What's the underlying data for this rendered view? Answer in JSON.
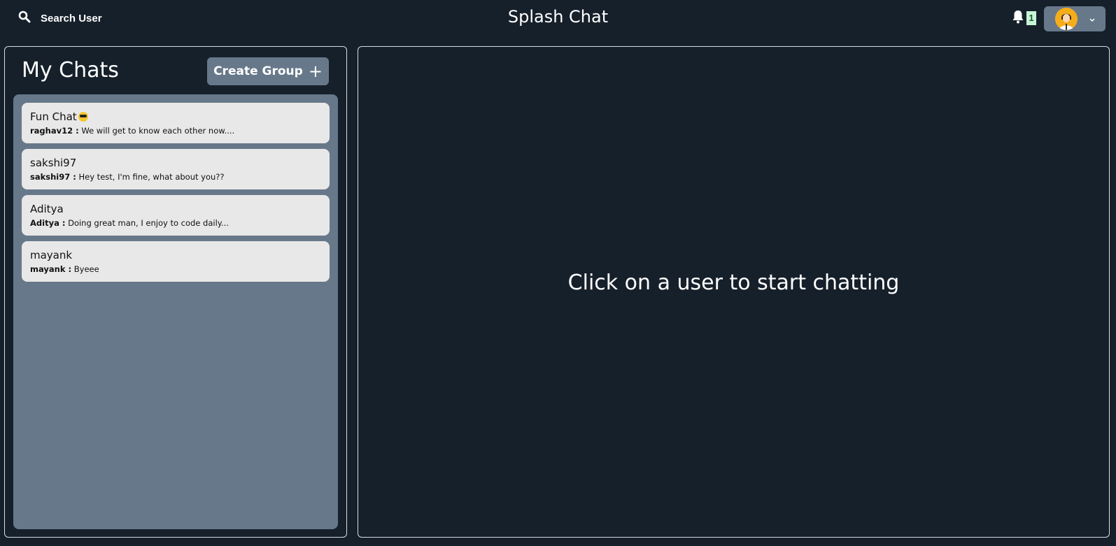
{
  "header": {
    "search_label": "Search User",
    "app_title": "Splash Chat",
    "notification_count": "1"
  },
  "sidebar": {
    "title": "My Chats",
    "create_group_label": "Create Group",
    "chats": [
      {
        "name": "Fun Chat",
        "sender": "raghav12 :",
        "message": "We will get to know each other now...."
      },
      {
        "name": "sakshi97",
        "sender": "sakshi97 :",
        "message": "Hey test, I'm fine, what about you??"
      },
      {
        "name": "Aditya",
        "sender": "Aditya :",
        "message": "Doing great man, I enjoy to code daily..."
      },
      {
        "name": "mayank",
        "sender": "mayank :",
        "message": "Byeee"
      }
    ]
  },
  "main": {
    "empty_message": "Click on a user to start chatting"
  },
  "colors": {
    "background": "#16202b",
    "accent": "#67788a",
    "chat_item": "#e8e8e8",
    "badge": "#c6f6d5"
  },
  "icons": [
    "search-icon",
    "bell-icon",
    "avatar-icon",
    "chevron-down-icon",
    "plus-icon",
    "sunglasses-emoji-icon"
  ]
}
